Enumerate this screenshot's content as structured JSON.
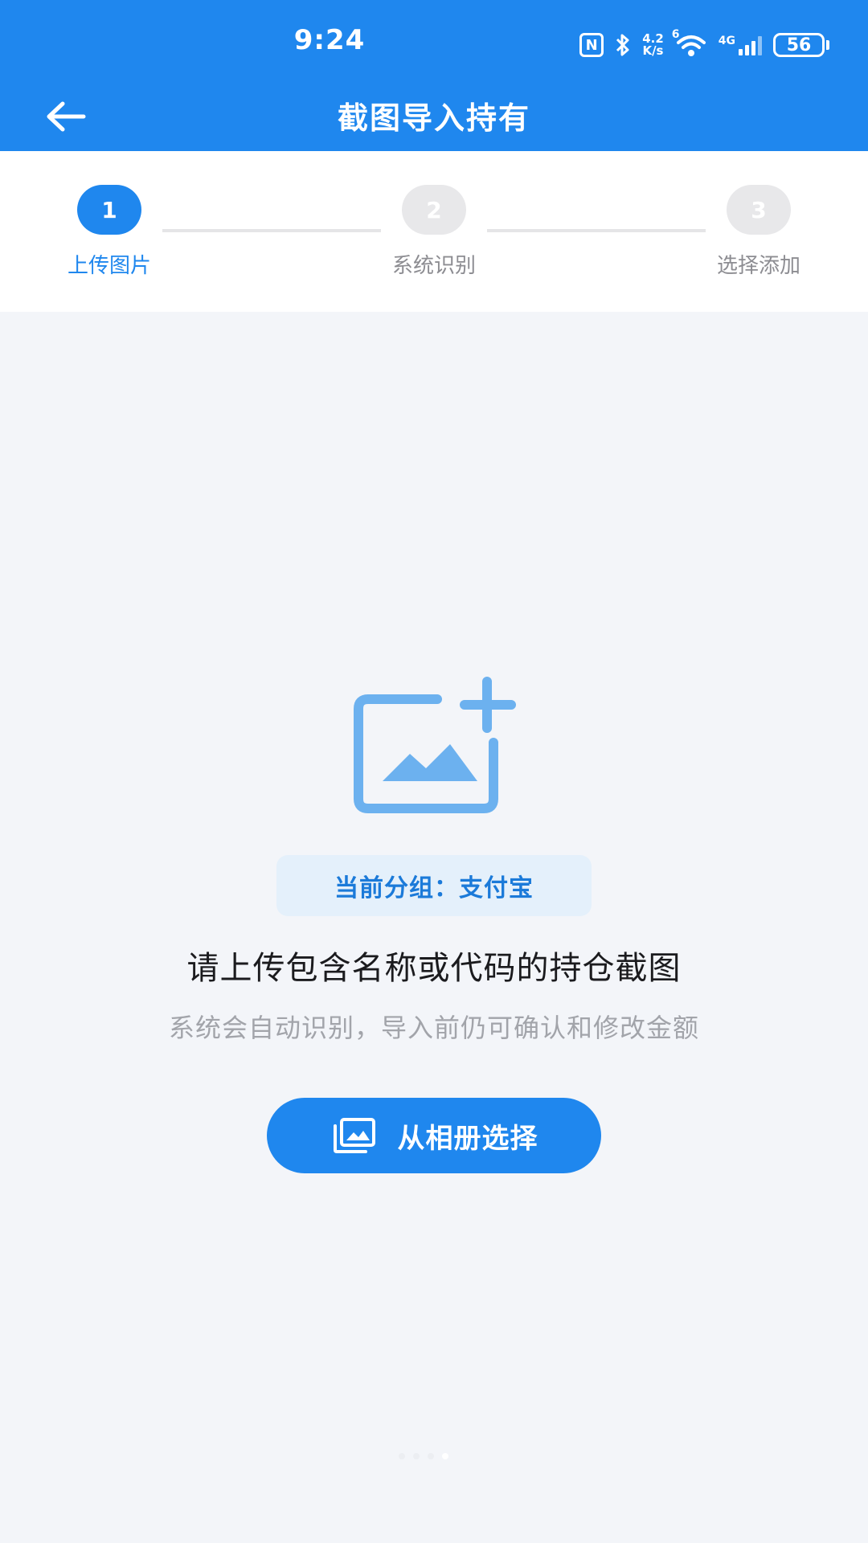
{
  "status_bar": {
    "time": "9:24",
    "nfc_label": "N",
    "net_speed_value": "4.2",
    "net_speed_unit": "K/s",
    "wifi_badge": "6",
    "cell_label": "4G",
    "battery": "56"
  },
  "header": {
    "title": "截图导入持有",
    "back_icon": "arrow-left-icon"
  },
  "steps": [
    {
      "number": "1",
      "label": "上传图片",
      "state": "active"
    },
    {
      "number": "2",
      "label": "系统识别",
      "state": "inactive"
    },
    {
      "number": "3",
      "label": "选择添加",
      "state": "inactive"
    }
  ],
  "main": {
    "upload_icon": "add-image-icon",
    "group_tag": "当前分组：支付宝",
    "headline": "请上传包含名称或代码的持仓截图",
    "subline": "系统会自动识别，导入前仍可确认和修改金额",
    "album_button": "从相册选择",
    "album_icon": "photo-album-icon"
  },
  "colors": {
    "primary": "#1f87ee",
    "background": "#f3f5f9",
    "tag_background": "#e4f0fb",
    "icon_light": "#6cb1ef"
  }
}
